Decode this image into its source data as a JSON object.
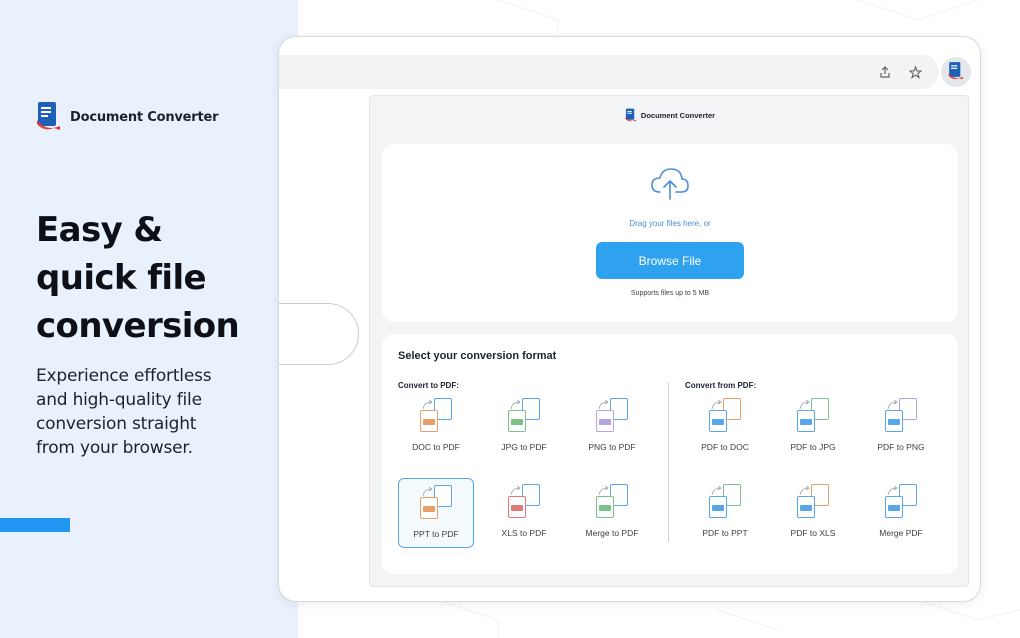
{
  "promo": {
    "brand_name": "Document Converter",
    "headline_line1": "Easy &",
    "headline_line2": "quick file",
    "headline_line3": "conversion",
    "subtext_line1": "Experience effortless",
    "subtext_line2": "and high-quality file",
    "subtext_line3": "conversion straight",
    "subtext_line4": "from your browser."
  },
  "browser": {
    "icons": [
      "share-icon",
      "star-icon",
      "extension-icon"
    ]
  },
  "popup": {
    "header_name": "Document Converter",
    "upload": {
      "drag_text": "Drag your files here, or",
      "browse_label": "Browse File",
      "supports_text": "Supports files up to 5 MB"
    },
    "formats": {
      "title": "Select your conversion format",
      "to_pdf_label": "Convert to PDF:",
      "from_pdf_label": "Convert from PDF:",
      "to_pdf": [
        {
          "label": "DOC to PDF",
          "color": "#e8a06a"
        },
        {
          "label": "JPG to PDF",
          "color": "#7cc08a"
        },
        {
          "label": "PNG to PDF",
          "color": "#b8a3dc"
        },
        {
          "label": "PPT to PDF",
          "color": "#e8a06a"
        },
        {
          "label": "XLS to PDF",
          "color": "#e07a7a"
        },
        {
          "label": "Merge to PDF",
          "color": "#7cc08a"
        }
      ],
      "from_pdf": [
        {
          "label": "PDF to DOC",
          "color": "#e8a06a"
        },
        {
          "label": "PDF to JPG",
          "color": "#7cc08a"
        },
        {
          "label": "PDF to PNG",
          "color": "#b8a3dc"
        },
        {
          "label": "PDF to PPT",
          "color": "#7cc08a"
        },
        {
          "label": "PDF to XLS",
          "color": "#e8a06a"
        },
        {
          "label": "Merge PDF",
          "color": "#5aa6ea"
        }
      ]
    }
  },
  "colors": {
    "accent": "#2196f3",
    "button": "#2fa2ef",
    "panel_bg": "#e9f1fd",
    "pdf_blue": "#5aa6ea"
  }
}
